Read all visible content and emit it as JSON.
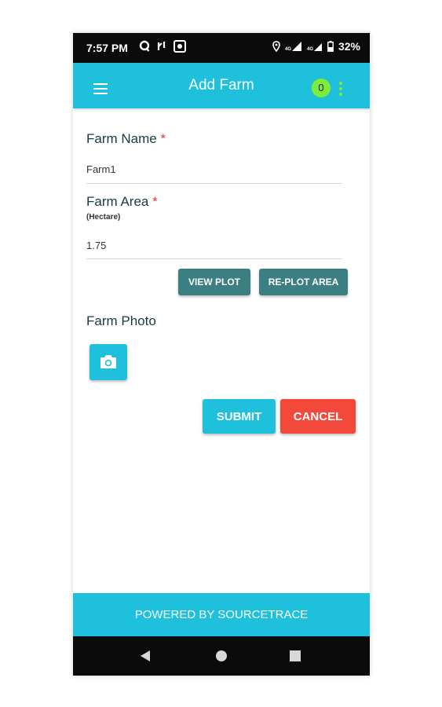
{
  "status_bar": {
    "time": "7:57 PM",
    "battery": "32%",
    "icons_left": [
      "q-app-icon",
      "call-forward-icon",
      "camera-notification-icon"
    ],
    "icons_right": [
      "location-icon",
      "signal-4g-icon",
      "signal-4g-icon-2",
      "battery-icon"
    ]
  },
  "app_bar": {
    "title": "Add Farm",
    "badge_count": "0",
    "accent_color": "#1ec0dc",
    "badge_color": "#7dec3c"
  },
  "form": {
    "farm_name": {
      "label": "Farm Name",
      "required_mark": "*",
      "value": "Farm1"
    },
    "farm_area": {
      "label": "Farm Area",
      "required_mark": "*",
      "unit": "(Hectare)",
      "value": "1.75"
    },
    "view_plot_label": "VIEW PLOT",
    "replot_label": "RE-PLOT AREA",
    "farm_photo_label": "Farm Photo",
    "submit_label": "SUBMIT",
    "cancel_label": "CANCEL"
  },
  "footer": {
    "text": "POWERED BY SOURCETRACE"
  },
  "colors": {
    "dark_button": "#3b7f82",
    "cancel": "#f2493b",
    "required": "#e53935"
  }
}
